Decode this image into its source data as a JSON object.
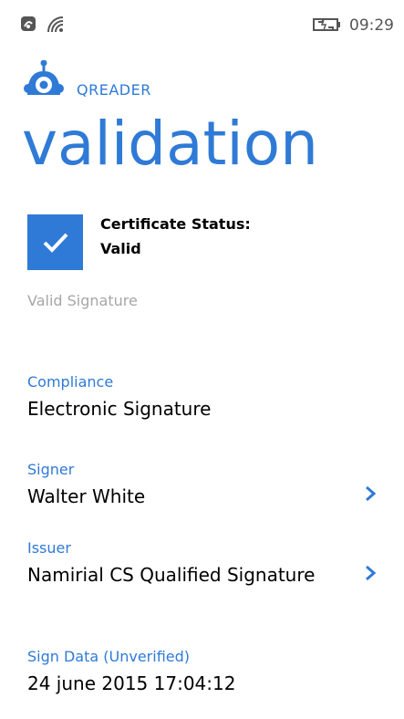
{
  "status_bar": {
    "time": "09:29",
    "icons": [
      "nfc-icon",
      "wifi-icon",
      "battery-charging-icon"
    ]
  },
  "app": {
    "name": "QREADER",
    "logo": "robot-logo-icon",
    "accent_color": "#2f7ad6"
  },
  "page": {
    "title": "validation"
  },
  "certificate": {
    "status_label": "Certificate Status:",
    "status_value": "Valid",
    "status_icon": "checkmark-icon",
    "description": "Valid Signature"
  },
  "fields": {
    "compliance": {
      "label": "Compliance",
      "value": "Electronic Signature"
    },
    "signer": {
      "label": "Signer",
      "value": "Walter White"
    },
    "issuer": {
      "label": "Issuer",
      "value": "Namirial CS Qualified Signature"
    },
    "sign_data": {
      "label": "Sign Data (Unverified)",
      "value": "24 june 2015 17:04:12"
    }
  }
}
